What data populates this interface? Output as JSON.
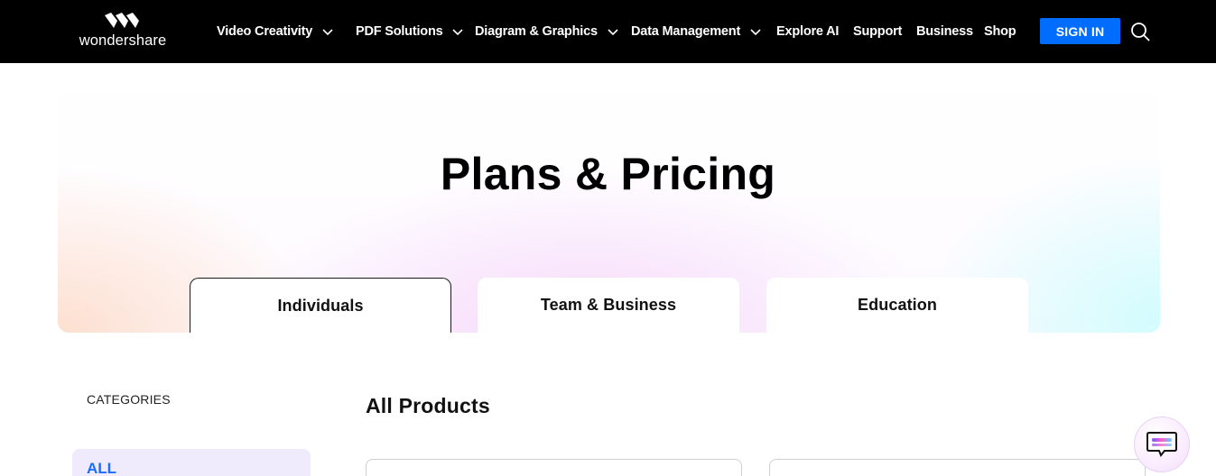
{
  "header": {
    "logo_text": "wondershare",
    "logo_icon": "wondershare-w-icon",
    "nav_items": [
      {
        "label": "Video Creativity",
        "has_dropdown": true
      },
      {
        "label": "PDF Solutions",
        "has_dropdown": true
      },
      {
        "label": "Diagram & Graphics",
        "has_dropdown": true
      },
      {
        "label": "Data Management",
        "has_dropdown": true
      },
      {
        "label": "Explore AI",
        "has_dropdown": false
      },
      {
        "label": "Support",
        "has_dropdown": false
      },
      {
        "label": "Business",
        "has_dropdown": false
      },
      {
        "label": "Shop",
        "has_dropdown": false
      }
    ],
    "signin_label": "SIGN IN",
    "search_icon": "search-icon"
  },
  "hero": {
    "title": "Plans & Pricing",
    "tabs": [
      {
        "label": "Individuals",
        "active": true
      },
      {
        "label": "Team & Business",
        "active": false
      },
      {
        "label": "Education",
        "active": false
      }
    ]
  },
  "sidebar": {
    "heading": "CATEGORIES",
    "items": [
      {
        "label": "ALL",
        "active": true
      }
    ]
  },
  "main": {
    "title": "All Products"
  },
  "chat": {
    "icon": "chat-bubble-icon"
  },
  "colors": {
    "topbar_bg": "#000000",
    "accent_blue": "#006dff",
    "active_category_bg": "#efebfc",
    "active_category_text": "#1a6dff"
  }
}
